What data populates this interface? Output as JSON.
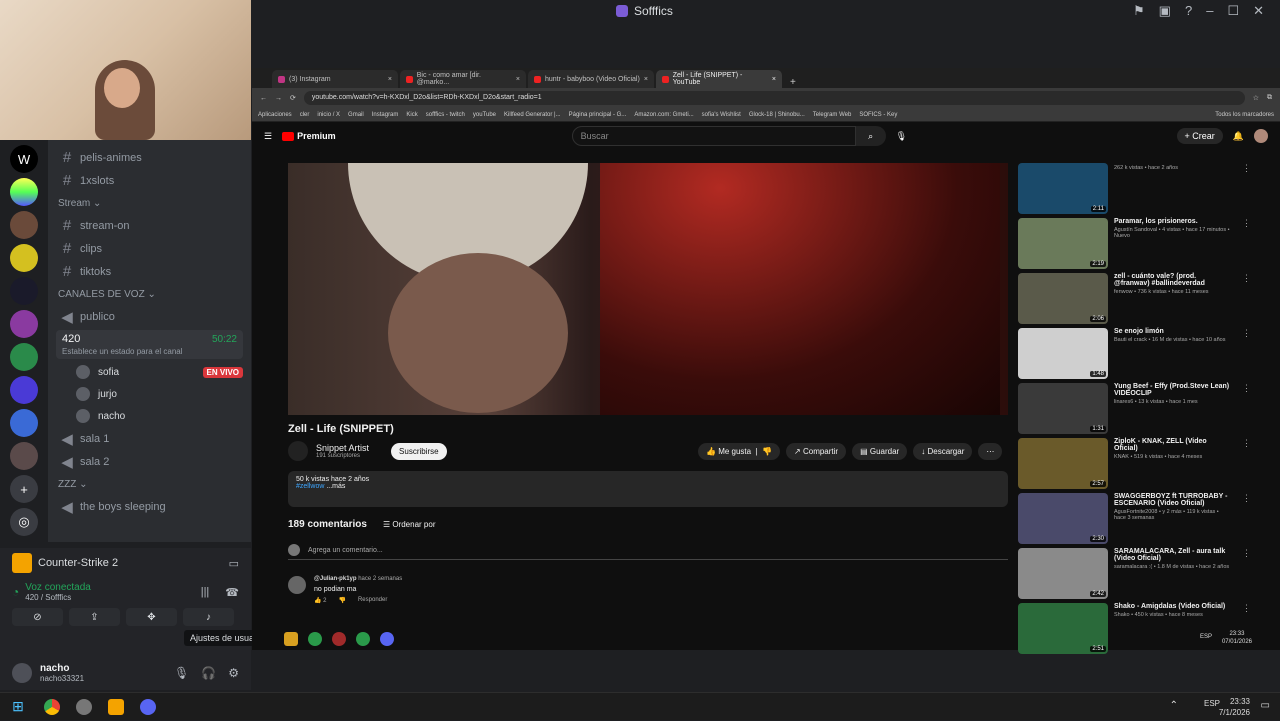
{
  "window": {
    "title": "Sofffics"
  },
  "discord": {
    "channels": [
      {
        "label": "pelis-animes"
      },
      {
        "label": "1xslots"
      }
    ],
    "stream_category": "Stream",
    "stream_channels": [
      {
        "label": "stream-on"
      },
      {
        "label": "clips"
      },
      {
        "label": "tiktoks"
      }
    ],
    "voice_category": "CANALES DE VOZ",
    "voice_channels_top": [
      {
        "label": "publico"
      }
    ],
    "active_voice": {
      "name": "420",
      "time": "50:22",
      "status": "Establece un estado para el canal"
    },
    "voice_users": [
      {
        "name": "sofia",
        "live": "EN VIVO"
      },
      {
        "name": "jurjo",
        "live": ""
      },
      {
        "name": "nacho",
        "live": ""
      }
    ],
    "voice_channels_bottom": [
      {
        "label": "sala 1"
      },
      {
        "label": "sala 2"
      }
    ],
    "zzz_category": "zzz",
    "zzz_channels": [
      {
        "label": "the boys sleeping"
      }
    ],
    "game": "Counter-Strike 2",
    "voice_connected": "Voz conectada",
    "voice_location": "420 / Sofffics",
    "user": {
      "display": "nacho",
      "tag": "nacho33321"
    },
    "tooltip": "Ajustes de usuario"
  },
  "browser": {
    "tabs": [
      {
        "label": "(3) Instagram"
      },
      {
        "label": "Bic - como amar [dir. @marko..."
      },
      {
        "label": "huntr - babyboo (Video Oficial)"
      },
      {
        "label": "Zell - Life (SNIPPET) - YouTube"
      }
    ],
    "url": "youtube.com/watch?v=h-KXDxl_D2o&list=RDh-KXDxl_D2o&start_radio=1",
    "bookmarks": [
      "Aplicaciones",
      "cler",
      "inicio / X",
      "Gmail",
      "Instagram",
      "Kick",
      "sofffics - twitch",
      "youTube",
      "Killfeed Generator |...",
      "Página principal - G...",
      "Amazon.com: Gmeti...",
      "sofia's Wishlist",
      "Glock-18 | Shinobu...",
      "Telegram Web",
      "SOFICS - Key",
      "Todos los marcadores"
    ],
    "yt_logo": "Premium",
    "search_placeholder": "Buscar",
    "create_label": "Crear",
    "video_title": "Zell - Life (SNIPPET)",
    "channel": {
      "name": "Snippet Artist",
      "subs": "191 suscriptores",
      "subscribe": "Suscribirse"
    },
    "actions": [
      "Me gusta",
      "Compartir",
      "Guardar",
      "Descargar"
    ],
    "desc": {
      "line1": "50 k vistas  hace 2 años",
      "tag": "#zellwow",
      "more": " ...más"
    },
    "comments_count": "189 comentarios",
    "sort_label": "Ordenar por",
    "add_comment": "Agrega un comentario...",
    "comment": {
      "author": "@Julian-pk1yp",
      "time": "hace 2 semanas",
      "text": "no podian ma",
      "likes": "2",
      "reply": "Responder"
    },
    "recommended": [
      {
        "title": "",
        "sub": "262 k vistas • hace 2 años",
        "dur": "2:11",
        "color": "#1a4a6a"
      },
      {
        "title": "Paramar, los prisioneros.",
        "sub": "Agustín Sandoval • 4 vistas • hace 17 minutos • Nuevo",
        "dur": "2:19",
        "color": "#6a7a5a"
      },
      {
        "title": "zell - cuánto vale? (prod. @franwav) #ballindeverdad",
        "sub": "fenwow • 736 k vistas • hace 11 meses",
        "dur": "2:06",
        "color": "#5a5a4a"
      },
      {
        "title": "Se enojo limón",
        "sub": "Bauti el crack • 16 M de vistas • hace 10 años",
        "dur": "1:48",
        "color": "#cfcfcf"
      },
      {
        "title": "Yung Beef - Effy (Prod.Steve Lean) VIDEOCLIP",
        "sub": "linares6 • 13 k vistas • hace 1 mes",
        "dur": "1:31",
        "color": "#3a3a3a"
      },
      {
        "title": "ZiploK - KNAK, ZELL (Video Oficial)",
        "sub": "KNAK • 519 k vistas • hace 4 meses",
        "dur": "2:57",
        "color": "#6a5a2a"
      },
      {
        "title": "SWAGGERBOYZ ft TURROBABY - ESCENARIO (Video Oficial)",
        "sub": "AgusFortnite2008 • y 2 más • 119 k vistas • hace 3 semanas",
        "dur": "2:30",
        "color": "#4a4a6a"
      },
      {
        "title": "SARAMALACARA, Zell - aura talk (Video Oficial)",
        "sub": "saramalacara :( • 1.8 M de vistas • hace 2 años",
        "dur": "2:42",
        "color": "#8a8a8a"
      },
      {
        "title": "Shako - Amigdalas (Video Oficial)",
        "sub": "Shako • 450 k vistas • hace 8 meses",
        "dur": "2:51",
        "color": "#2a6a3a"
      }
    ],
    "inner_lang": "ESP",
    "inner_time": "23:33",
    "inner_date": "07/01/2026"
  },
  "taskbar": {
    "lang": "ESP",
    "time": "23:33",
    "date": "7/1/2026"
  }
}
